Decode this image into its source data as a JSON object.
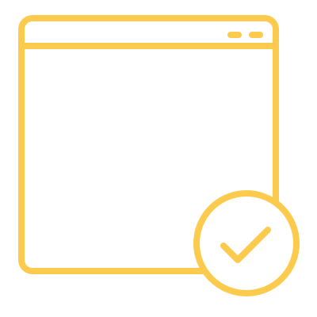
{
  "icon": {
    "name": "browser-window-check-icon",
    "parts": [
      "browser-window-icon",
      "title-bar-divider",
      "window-control-dashes",
      "check-badge-icon",
      "checkmark-icon"
    ]
  },
  "colors": {
    "stroke": "#FCCA4C",
    "background": "#FFFFFF",
    "badge_fill": "#FFFFFF"
  }
}
